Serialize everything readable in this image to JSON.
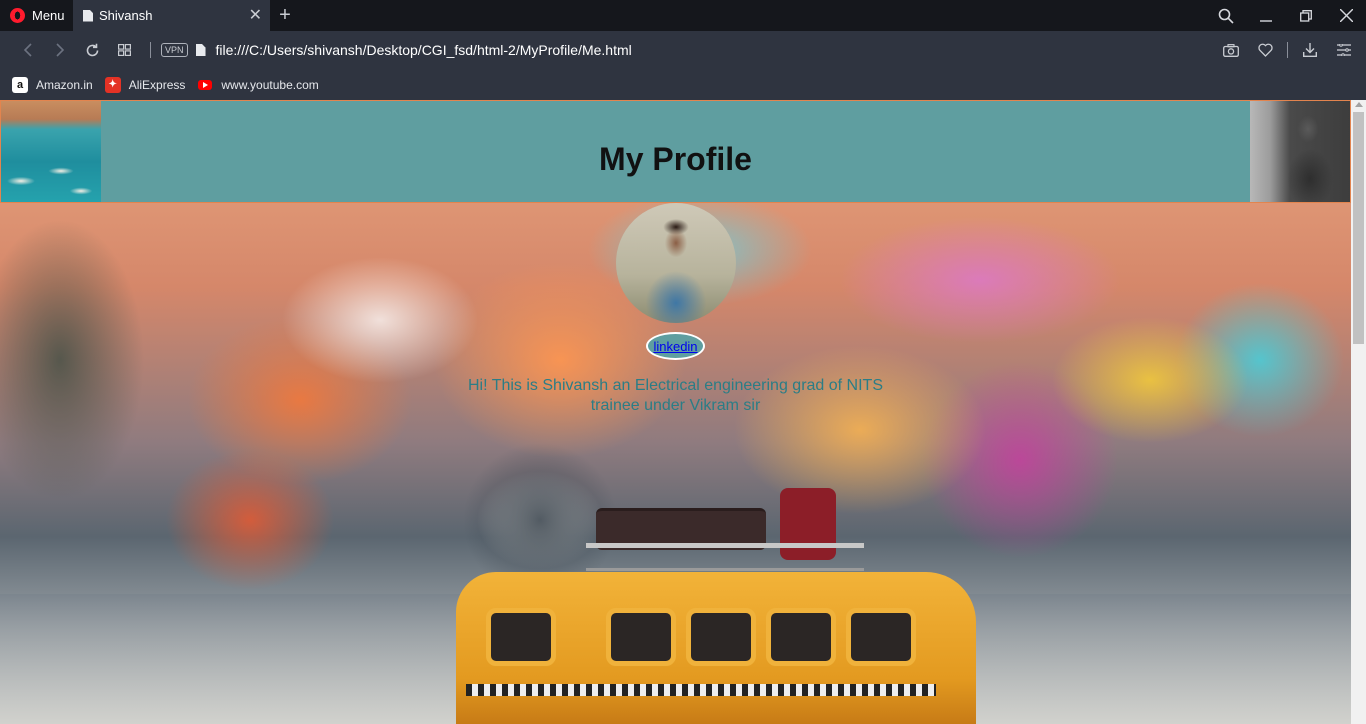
{
  "browser": {
    "menu_label": "Menu",
    "tab_title": "Shivansh",
    "url": "file:///C:/Users/shivansh/Desktop/CGI_fsd/html-2/MyProfile/Me.html",
    "vpn_label": "VPN",
    "bookmarks": [
      {
        "label": "Amazon.in",
        "icon": "amazon-icon",
        "glyph": "a"
      },
      {
        "label": "AliExpress",
        "icon": "aliexpress-icon",
        "glyph": "✦"
      },
      {
        "label": "www.youtube.com",
        "icon": "youtube-icon",
        "glyph": ""
      }
    ]
  },
  "page": {
    "title": "My Profile",
    "linkedin_label": "linkedin",
    "bio_line1": "Hi! This is Shivansh an Electrical engineering grad of NITS",
    "bio_line2": "trainee under Vikram sir",
    "header_color": "#5f9ea0",
    "bio_color": "#2b7d86"
  }
}
